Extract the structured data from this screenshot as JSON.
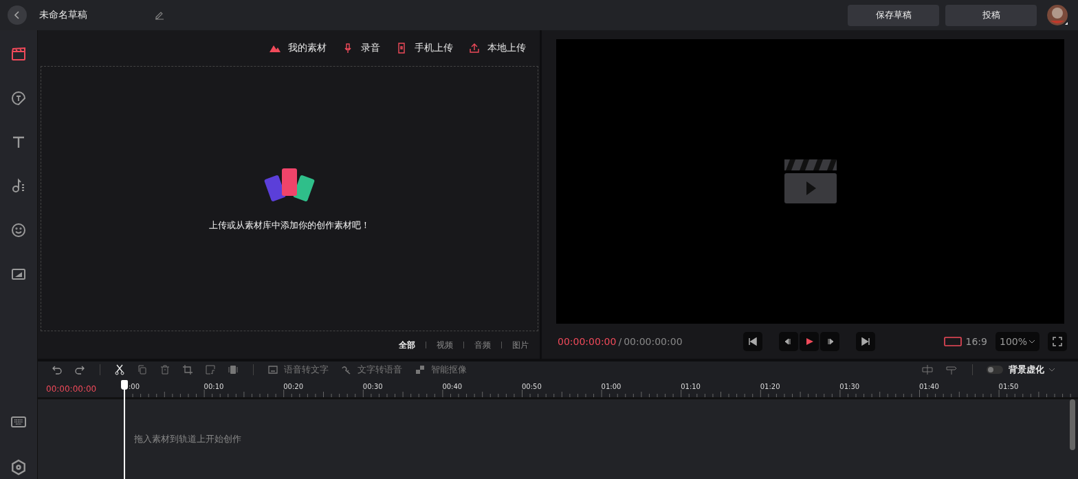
{
  "project": {
    "title": "未命名草稿"
  },
  "header_buttons": [
    {
      "label": "保存草稿"
    },
    {
      "label": "投稿"
    }
  ],
  "sidebar": {
    "tools": [
      {
        "kind": "media",
        "selected": true
      },
      {
        "kind": "sticker",
        "selected": false
      },
      {
        "kind": "text",
        "selected": false
      },
      {
        "kind": "audio",
        "selected": false
      },
      {
        "kind": "emoji",
        "selected": false
      },
      {
        "kind": "filter",
        "selected": false
      }
    ]
  },
  "media_panel": {
    "sources": [
      {
        "kind": "library",
        "label": "我的素材"
      },
      {
        "kind": "record",
        "label": "录音"
      },
      {
        "kind": "phone",
        "label": "手机上传"
      },
      {
        "kind": "local",
        "label": "本地上传"
      }
    ],
    "empty_message": "上传或从素材库中添加你的创作素材吧！",
    "filters": [
      {
        "label": "全部",
        "selected": true
      },
      {
        "label": "视频",
        "selected": false
      },
      {
        "label": "音频",
        "selected": false
      },
      {
        "label": "图片",
        "selected": false
      }
    ]
  },
  "preview": {
    "current_time": "00:00:00:00",
    "separator": "/",
    "total_time": "00:00:00:00",
    "aspect_ratio": "16:9",
    "zoom": "100%"
  },
  "timeline": {
    "tools": [
      {
        "kind": "speech",
        "label": "语音转文字"
      },
      {
        "kind": "tts",
        "label": "文字转语音"
      },
      {
        "kind": "matting",
        "label": "智能抠像"
      }
    ],
    "current_time": "00:00:00:00",
    "ruler_labels": [
      ":00",
      "00:10",
      "00:20",
      "00:30",
      "00:40",
      "00:50",
      "01:00",
      "01:10",
      "01:20",
      "01:30",
      "01:40",
      "01:50"
    ],
    "background_blur": {
      "label": "背景虚化",
      "on": false
    },
    "empty_hint": "拖入素材到轨道上开始创作"
  }
}
